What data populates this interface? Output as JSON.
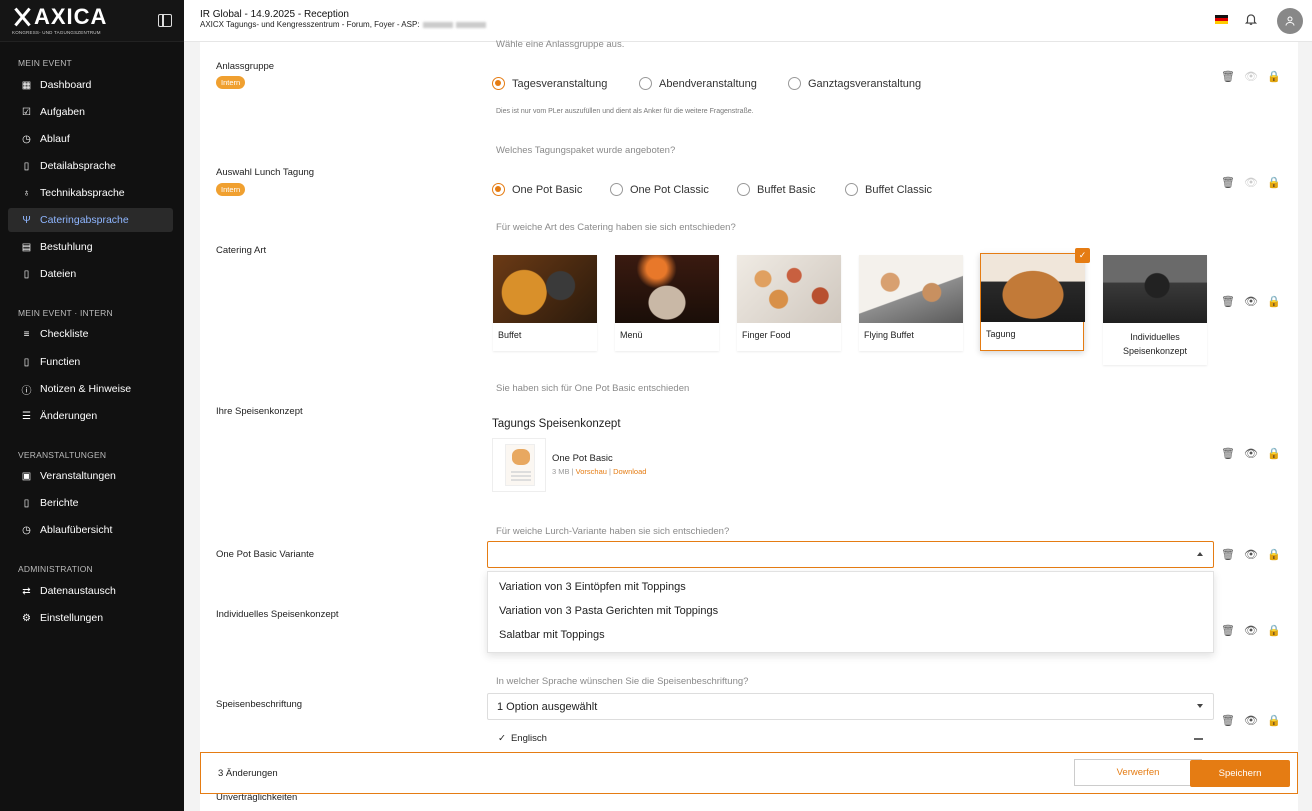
{
  "sidebar": {
    "logo_main": "AXICA",
    "logo_sub": "KONGRESS- UND TAGUNGSZENTRUM",
    "sections": [
      {
        "title": "MEIN EVENT",
        "items": [
          {
            "label": "Dashboard",
            "icon": "dashboard-icon"
          },
          {
            "label": "Aufgaben",
            "icon": "tasks-icon"
          },
          {
            "label": "Ablauf",
            "icon": "clock-icon"
          },
          {
            "label": "Detailabsprache",
            "icon": "document-icon"
          },
          {
            "label": "Technikabsprache",
            "icon": "microphone-icon"
          },
          {
            "label": "Cateringabsprache",
            "icon": "cutlery-icon",
            "active": true
          },
          {
            "label": "Bestuhlung",
            "icon": "seating-icon"
          },
          {
            "label": "Dateien",
            "icon": "file-icon"
          }
        ]
      },
      {
        "title": "MEIN EVENT · INTERN",
        "items": [
          {
            "label": "Checkliste",
            "icon": "checklist-icon"
          },
          {
            "label": "Functien",
            "icon": "document-icon"
          },
          {
            "label": "Notizen & Hinweise",
            "icon": "info-icon"
          },
          {
            "label": "Änderungen",
            "icon": "list-icon"
          }
        ]
      },
      {
        "title": "VERANSTALTUNGEN",
        "items": [
          {
            "label": "Veranstaltungen",
            "icon": "calendar-icon"
          },
          {
            "label": "Berichte",
            "icon": "file-icon"
          },
          {
            "label": "Ablaufübersicht",
            "icon": "clock-icon"
          }
        ]
      },
      {
        "title": "ADMINISTRATION",
        "items": [
          {
            "label": "Datenaustausch",
            "icon": "swap-icon"
          },
          {
            "label": "Einstellungen",
            "icon": "gear-icon"
          }
        ]
      }
    ]
  },
  "topbar": {
    "title": "IR Global - 14.9.2025 - Reception",
    "subtitle": "AXICX Tagungs- und Kengresszentrum - Forum, Foyer - ASP:",
    "language_flag": "de-flag-icon",
    "notifications_icon": "bell-icon",
    "avatar_icon": "user-icon"
  },
  "form": {
    "cut_hint": "Wähle eine Anlassgruppe aus.",
    "anlass": {
      "label": "Anlassgruppe",
      "badge": "Intern",
      "options": [
        "Tagesveranstaltung",
        "Abendveranstaltung",
        "Ganztagsveranstaltung"
      ],
      "selected": 0,
      "note": "Dies ist nur vom PLer auszufüllen und dient als Anker für die weitere Fragenstraße."
    },
    "lunch": {
      "hint": "Welches Tagungspaket wurde angeboten?",
      "label": "Auswahl Lunch Tagung",
      "badge": "Intern",
      "options": [
        "One Pot Basic",
        "One Pot Classic",
        "Buffet Basic",
        "Buffet Classic"
      ],
      "selected": 0
    },
    "catering": {
      "hint": "Für weiche Art des Catering haben sie sich entschieden?",
      "label": "Catering Art",
      "cards": [
        "Buffet",
        "Menü",
        "Finger Food",
        "Flying Buffet",
        "Tagung",
        "Individuelles Speisenkonzept"
      ],
      "selected": 4
    },
    "konzept": {
      "hint": "Sie haben sich für One Pot Basic entschieden",
      "label": "Ihre Speisenkonzept",
      "heading": "Tagungs Speisenkonzept",
      "file_name": "One Pot Basic",
      "file_size": "3 MB",
      "preview": "Vorschau",
      "download": "Download",
      "sep": "|"
    },
    "variante": {
      "hint": "Für weiche Lurch-Variante haben sie sich entschieden?",
      "label": "One Pot Basic Variante",
      "options": [
        "Variation von 3 Eintöpfen mit Toppings",
        "Variation von 3 Pasta Gerichten mit Toppings",
        "Salatbar mit Toppings"
      ]
    },
    "individuell": {
      "label": "Individuelles Speisenkonzept"
    },
    "beschriftung": {
      "hint": "In welcher Sprache wünschen Sie die Speisenbeschriftung?",
      "label": "Speisenbeschriftung",
      "value": "1 Option ausgewählt",
      "checked_option": "Englisch"
    },
    "cut_label": "Unverträglichkeiten"
  },
  "savebar": {
    "changes": "3 Änderungen",
    "discard": "Verwerfen",
    "save": "Speichern"
  },
  "colors": {
    "accent": "#e57c13",
    "sidebar_bg": "#111111",
    "active_nav": "#8fb6ff"
  }
}
